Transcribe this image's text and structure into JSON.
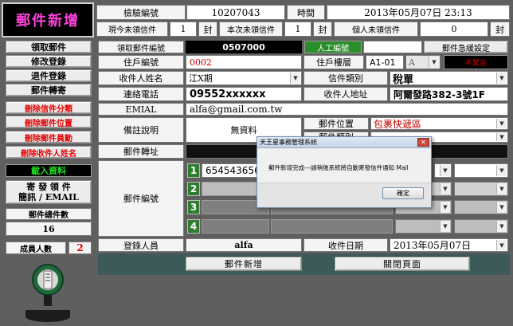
{
  "header": {
    "title": "郵件新增",
    "inspect_no_label": "檢驗編號",
    "inspect_no": "10207043",
    "time_label": "時間",
    "time_value": "2013年05月07日 23:13",
    "unclaimed_now_label": "現今未領信件",
    "unclaimed_now": "1",
    "unit1": "封",
    "unclaimed_this_label": "本次未領信件",
    "unclaimed_this": "1",
    "unit2": "封",
    "personal_unclaimed_label": "個人未領信件",
    "personal_unclaimed": "0",
    "unit3": "封"
  },
  "sidebar": {
    "buttons": [
      {
        "label": "領取郵件",
        "red": false
      },
      {
        "label": "修改登錄",
        "red": false
      },
      {
        "label": "退件登錄",
        "red": false
      },
      {
        "label": "郵件轉寄",
        "red": false
      },
      {
        "label": "刪除信件分類",
        "red": true
      },
      {
        "label": "刪除郵件位置",
        "red": true
      },
      {
        "label": "刪除郵件員動",
        "red": true
      },
      {
        "label": "刪除收件人姓名",
        "red": true
      }
    ],
    "load_label": "載入資料",
    "send_label_1": "寄 發 領 件",
    "send_label_2": "簡訊 / EMAIL",
    "total_label": "郵件總件數",
    "total_value": "16",
    "members_label": "成員人數",
    "members_value": "2"
  },
  "form": {
    "claim_no_label": "領取郵件編號",
    "claim_no": "0507000",
    "manual_btn": "人工編號",
    "urgent_btn": "郵件急緩設定",
    "household_no_label": "住戶編號",
    "household_no": "0002",
    "household_floor_label": "住戶樓層",
    "household_floor": "A1-01",
    "floor_letter": "A",
    "urgency_value": "不緊急",
    "recipient_label": "收件人姓名",
    "recipient": "江X期",
    "letter_type_label": "信件類別",
    "letter_type": "稅單",
    "phone_label": "連絡電話",
    "phone": "09552xxxxxx",
    "address_label": "收件人地址",
    "address": "阿爾發路382-3號1F",
    "email_label": "EMIAL",
    "email": "alfa@gmail.com.tw",
    "remark_label": "備註說明",
    "remark_value": "無資料",
    "location_label": "郵件位置",
    "location_value": "包裹快遞區",
    "category_label": "郵件類別",
    "transfer_label": "郵件轉址",
    "mail_no_label": "郵件編號",
    "mail_rows": [
      {
        "n": "1",
        "value": "6545436565"
      },
      {
        "n": "2",
        "value": ""
      },
      {
        "n": "3",
        "value": ""
      },
      {
        "n": "4",
        "value": ""
      }
    ],
    "registrar_label": "登錄人員",
    "registrar": "alfa",
    "receive_date_label": "收件日期",
    "receive_date": "2013年05月07日",
    "add_btn": "郵件新增",
    "close_btn": "關閉頁面"
  },
  "dialog": {
    "title": "天王星事務管理系統",
    "message": "郵件新增完成---請稍後系統將自動寄發信件通知 Mail",
    "ok": "確定"
  }
}
